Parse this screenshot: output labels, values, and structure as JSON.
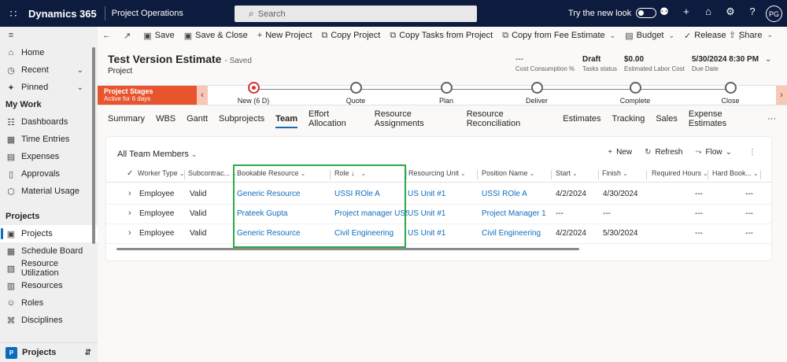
{
  "topbar": {
    "brand": "Dynamics 365",
    "app": "Project Operations",
    "search_placeholder": "Search",
    "try_new_look": "Try the new look",
    "avatar": "PG"
  },
  "sidebar": {
    "items": [
      {
        "label": "Home",
        "icon": "home-icon"
      },
      {
        "label": "Recent",
        "icon": "clock-icon"
      },
      {
        "label": "Pinned",
        "icon": "pin-icon"
      }
    ],
    "section1": "My Work",
    "mywork": [
      "Dashboards",
      "Time Entries",
      "Expenses",
      "Approvals",
      "Material Usage"
    ],
    "section2": "Projects",
    "projects": [
      "Projects",
      "Schedule Board",
      "Resource Utilization",
      "Resources",
      "Roles",
      "Disciplines"
    ],
    "bottom_badge": "P",
    "bottom_label": "Projects"
  },
  "cmdbar": {
    "save": "Save",
    "save_close": "Save & Close",
    "new_project": "New Project",
    "copy_project": "Copy Project",
    "copy_tasks": "Copy Tasks from Project",
    "copy_fee": "Copy from Fee Estimate",
    "budget": "Budget",
    "release": "Release",
    "share": "Share"
  },
  "header": {
    "title": "Test Version Estimate",
    "saved": "- Saved",
    "entity": "Project",
    "fields": [
      {
        "value": "---",
        "label": "Cost Consumption %"
      },
      {
        "value": "Draft",
        "label": "Tasks status"
      },
      {
        "value": "$0.00",
        "label": "Estimated Labor Cost"
      },
      {
        "value": "5/30/2024 8:30 PM",
        "label": "Due Date"
      }
    ]
  },
  "bpf": {
    "active_title": "Project Stages",
    "active_sub": "Active for 6 days",
    "stages": [
      "New  (6 D)",
      "Quote",
      "Plan",
      "Deliver",
      "Complete",
      "Close"
    ]
  },
  "tabs": [
    "Summary",
    "WBS",
    "Gantt",
    "Subprojects",
    "Team",
    "Effort Allocation",
    "Resource Assignments",
    "Resource Reconciliation",
    "Estimates",
    "Tracking",
    "Sales",
    "Expense Estimates",
    "···"
  ],
  "grid": {
    "view": "All Team Members",
    "new": "New",
    "refresh": "Refresh",
    "flow": "Flow",
    "columns": [
      "Worker Type",
      "Subcontrac...",
      "Bookable Resource",
      "Role ↓",
      "Resourcing Unit",
      "Position Name",
      "Start",
      "Finish",
      "Required Hours",
      "Hard Book..."
    ],
    "rows": [
      [
        "Employee",
        "Valid",
        "Generic Resource",
        "USSI ROle A",
        "US Unit #1",
        "USSI ROle A",
        "4/2/2024",
        "4/30/2024",
        "---",
        "---"
      ],
      [
        "Employee",
        "Valid",
        "Prateek Gupta",
        "Project manager USSI...",
        "US Unit #1",
        "Project Manager 1",
        "---",
        "---",
        "---",
        "---"
      ],
      [
        "Employee",
        "Valid",
        "Generic Resource",
        "Civil Engineering",
        "US Unit #1",
        "Civil Engineering",
        "4/2/2024",
        "5/30/2024",
        "---",
        "---"
      ]
    ]
  },
  "colors": {
    "topbar": "#0d1b3e",
    "accent": "#0f6cbd",
    "stage_active": "#e8542d",
    "highlight": "#2ea84a"
  }
}
